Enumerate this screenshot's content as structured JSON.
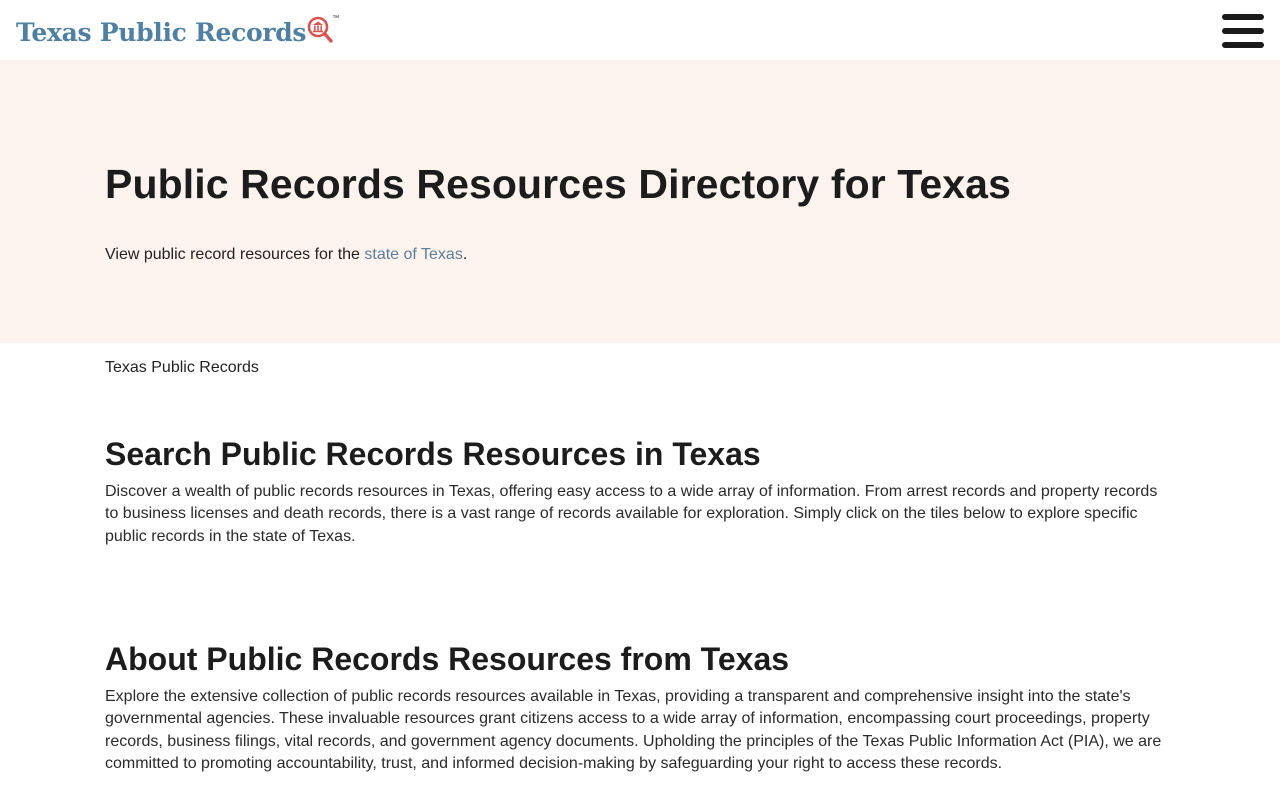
{
  "header": {
    "logo_text": "Texas Public Records",
    "logo_tm": "™",
    "menu_icon": "hamburger-icon",
    "brand_color": "#4f7fa1",
    "accent_color": "#d9534f"
  },
  "hero": {
    "title": "Public Records Resources Directory for Texas",
    "intro_prefix": "View public record resources for the ",
    "intro_link": "state of Texas",
    "intro_suffix": ".",
    "background": "#fcf3ee"
  },
  "breadcrumb": {
    "label": "Texas Public Records"
  },
  "sections": [
    {
      "title": "Search Public Records Resources in Texas",
      "text": "Discover a wealth of public records resources in Texas, offering easy access to a wide array of information. From arrest records and property records to business licenses and death records, there is a vast range of records available for exploration. Simply click on the tiles below to explore specific public records in the state of Texas."
    },
    {
      "title": "About Public Records Resources from Texas",
      "text": "Explore the extensive collection of public records resources available in Texas, providing a transparent and comprehensive insight into the state's governmental agencies. These invaluable resources grant citizens access to a wide array of information, encompassing court proceedings, property records, business filings, vital records, and government agency documents. Upholding the principles of the Texas Public Information Act (PIA), we are committed to promoting accountability, trust, and informed decision-making by safeguarding your right to access these records."
    }
  ]
}
